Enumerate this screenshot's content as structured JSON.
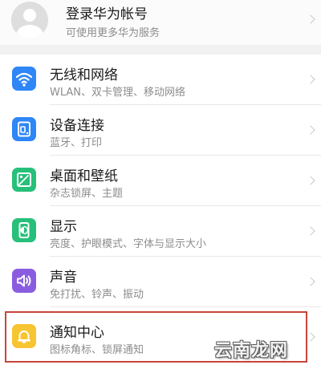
{
  "account": {
    "title": "登录华为帐号",
    "subtitle": "可使用更多华为服务",
    "avatar_icon": "default-avatar-icon"
  },
  "settings": [
    {
      "label": "无线和网络",
      "subtitle": "WLAN、双卡管理、移动网络",
      "icon": "wifi-icon",
      "color": "#2f86f6"
    },
    {
      "label": "设备连接",
      "subtitle": "蓝牙、打印",
      "icon": "device-connection-icon",
      "color": "#2f86f6"
    },
    {
      "label": "桌面和壁纸",
      "subtitle": "杂志锁屏、主题",
      "icon": "wallpaper-icon",
      "color": "#27c07a"
    },
    {
      "label": "显示",
      "subtitle": "亮度、护眼模式、字体与显示大小",
      "icon": "display-icon",
      "color": "#27c07a"
    },
    {
      "label": "声音",
      "subtitle": "免打扰、铃声、振动",
      "icon": "sound-icon",
      "color": "#8a5de0"
    },
    {
      "label": "通知中心",
      "subtitle": "图标角标、锁屏通知",
      "icon": "bell-icon",
      "color": "#f7c531"
    }
  ],
  "watermark": "云南龙网",
  "highlight_color": "#c9443c"
}
